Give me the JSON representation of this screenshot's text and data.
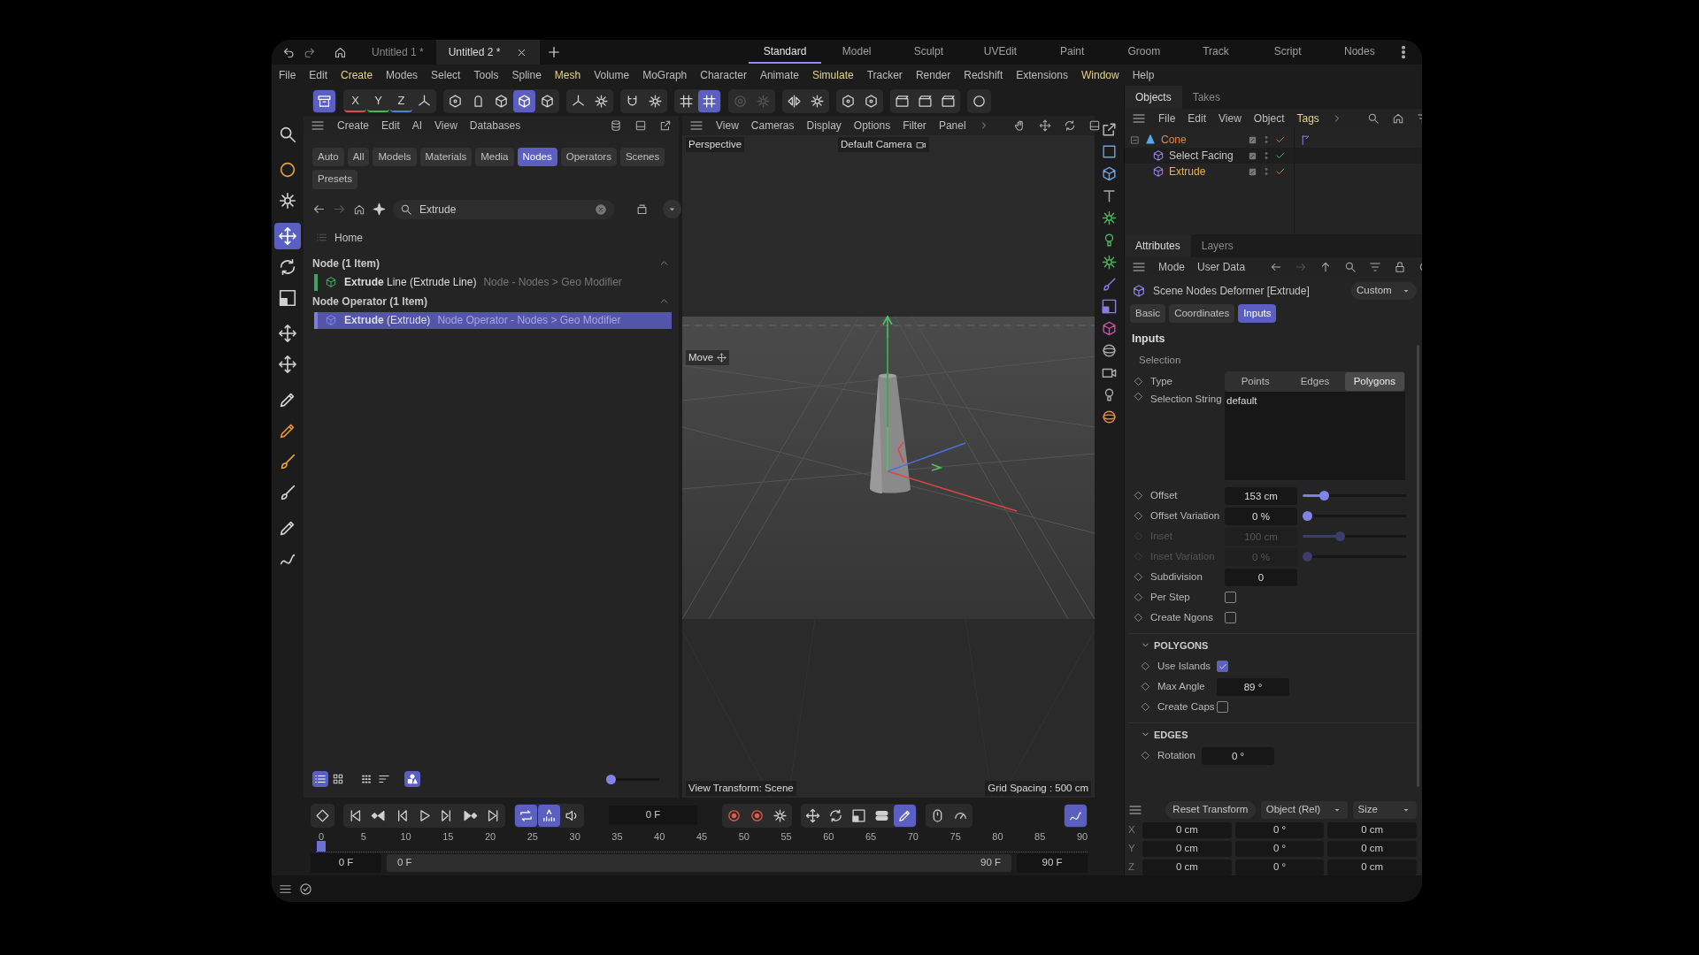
{
  "title_bar": {
    "documents": [
      {
        "label": "Untitled 1 *",
        "selected": false
      },
      {
        "label": "Untitled 2 *",
        "selected": true
      }
    ],
    "layouts": [
      {
        "label": "Standard",
        "selected": true
      },
      {
        "label": "Model",
        "selected": false
      },
      {
        "label": "Sculpt",
        "selected": false
      },
      {
        "label": "UVEdit",
        "selected": false
      },
      {
        "label": "Paint",
        "selected": false
      },
      {
        "label": "Groom",
        "selected": false
      },
      {
        "label": "Track",
        "selected": false
      },
      {
        "label": "Script",
        "selected": false
      },
      {
        "label": "Nodes",
        "selected": false
      }
    ]
  },
  "menu": [
    {
      "label": "File",
      "highlighted": false
    },
    {
      "label": "Edit",
      "highlighted": false
    },
    {
      "label": "Create",
      "highlighted": true
    },
    {
      "label": "Modes",
      "highlighted": false
    },
    {
      "label": "Select",
      "highlighted": false
    },
    {
      "label": "Tools",
      "highlighted": false
    },
    {
      "label": "Spline",
      "highlighted": false
    },
    {
      "label": "Mesh",
      "highlighted": true
    },
    {
      "label": "Volume",
      "highlighted": false
    },
    {
      "label": "MoGraph",
      "highlighted": false
    },
    {
      "label": "Character",
      "highlighted": false
    },
    {
      "label": "Animate",
      "highlighted": false
    },
    {
      "label": "Simulate",
      "highlighted": true
    },
    {
      "label": "Tracker",
      "highlighted": false
    },
    {
      "label": "Render",
      "highlighted": false
    },
    {
      "label": "Redshift",
      "highlighted": false
    },
    {
      "label": "Extensions",
      "highlighted": false
    },
    {
      "label": "Window",
      "highlighted": true
    },
    {
      "label": "Help",
      "highlighted": false
    }
  ],
  "toolbar": [
    [
      {
        "selected": true,
        "disabled": false
      }
    ],
    [
      {
        "label": "X",
        "selected": false,
        "disabled": false
      },
      {
        "label": "Y",
        "selected": false,
        "disabled": false
      },
      {
        "label": "Z",
        "selected": false,
        "disabled": false
      },
      {
        "selected": false,
        "disabled": false
      }
    ],
    [
      {
        "selected": false,
        "disabled": false
      },
      {
        "selected": false,
        "disabled": false
      },
      {
        "selected": false,
        "disabled": false
      },
      {
        "selected": true,
        "disabled": false
      },
      {
        "selected": false,
        "disabled": false
      }
    ],
    [
      {
        "selected": false,
        "disabled": false
      },
      {
        "selected": false,
        "disabled": false
      }
    ],
    [
      {
        "selected": false,
        "disabled": false
      },
      {
        "selected": false,
        "disabled": false
      }
    ],
    [
      {
        "selected": false,
        "disabled": false
      },
      {
        "selected": true,
        "disabled": false
      }
    ],
    [
      {
        "selected": false,
        "disabled": true
      },
      {
        "selected": false,
        "disabled": true
      }
    ],
    [
      {
        "selected": false,
        "disabled": false
      },
      {
        "selected": false,
        "disabled": false
      }
    ],
    [
      {
        "selected": false,
        "disabled": false
      },
      {
        "selected": false,
        "disabled": false
      }
    ],
    [
      {
        "selected": false,
        "disabled": false
      },
      {
        "selected": false,
        "disabled": false
      },
      {
        "selected": false,
        "disabled": false
      }
    ],
    [
      {
        "selected": false,
        "disabled": false
      }
    ]
  ],
  "tools": [
    {
      "selected": false
    },
    {
      "selected": false
    },
    {
      "selected": false
    },
    {
      "selected": true
    },
    {
      "selected": false
    },
    {
      "selected": false
    },
    {
      "selected": false
    },
    {
      "selected": false
    },
    {
      "selected": false
    },
    {
      "selected": false
    },
    {
      "selected": false
    },
    {
      "selected": false
    },
    {
      "selected": false
    },
    {
      "selected": false
    }
  ],
  "browser": {
    "menu": [
      "Create",
      "Edit",
      "AI",
      "View",
      "Databases"
    ],
    "filters": [
      {
        "label": "Auto",
        "selected": false
      },
      {
        "label": "All",
        "selected": false
      },
      {
        "label": "Models",
        "selected": false
      },
      {
        "label": "Materials",
        "selected": false
      },
      {
        "label": "Media",
        "selected": false
      },
      {
        "label": "Nodes",
        "selected": true
      },
      {
        "label": "Operators",
        "selected": false
      },
      {
        "label": "Scenes",
        "selected": false
      },
      {
        "label": "Presets",
        "selected": false
      }
    ],
    "search": {
      "value": "Extrude"
    },
    "breadcrumb": "Home",
    "groups": [
      {
        "title": "Node (1 Item)",
        "expanded": true,
        "items": [
          {
            "name": "**Extrude** Line (Extrude Line)",
            "path": "Node - Nodes > Geo Modifier",
            "color": "#3fa35f",
            "selected": false
          }
        ]
      },
      {
        "title": "Node Operator (1 Item)",
        "expanded": true,
        "items": [
          {
            "name": "**Extrude** (Extrude)",
            "path": "Node Operator - Nodes > Geo Modifier",
            "color": "#7a7fe0",
            "selected": true
          }
        ]
      }
    ],
    "view_buttons": [
      {
        "selected": true
      },
      {
        "selected": false
      },
      {
        "selected": false
      },
      {
        "selected": false
      },
      {
        "selected": true
      }
    ],
    "zoom": {
      "level": 0
    }
  },
  "viewport": {
    "menu": [
      "View",
      "Cameras",
      "Display",
      "Options",
      "Filter",
      "Panel"
    ],
    "view": "Perspective",
    "camera": "Default Camera",
    "tool": "Move",
    "view_transform": "View Transform: Scene",
    "grid_spacing": "Grid Spacing : 500 cm"
  },
  "objects": {
    "tabs": [
      {
        "label": "Objects",
        "selected": true
      },
      {
        "label": "Takes",
        "selected": false
      }
    ],
    "menu": [
      {
        "label": "File",
        "highlighted": false
      },
      {
        "label": "Edit",
        "highlighted": false
      },
      {
        "label": "View",
        "highlighted": false
      },
      {
        "label": "Object",
        "highlighted": false
      },
      {
        "label": "Tags",
        "highlighted": true
      }
    ],
    "tree": [
      {
        "label": "Cone",
        "kind": "primitive",
        "color": "#d98a45",
        "expanded": true,
        "enabled": true,
        "tagged": true,
        "children": [
          {
            "label": "Select Facing",
            "kind": "deformer",
            "color": "#c6c6c6",
            "enabled": true,
            "tagged": false
          },
          {
            "label": "Extrude",
            "kind": "deformer",
            "color": "#e8b44c",
            "enabled": true,
            "tagged": false
          }
        ]
      }
    ]
  },
  "attributes": {
    "tabs": [
      {
        "label": "Attributes",
        "selected": true
      },
      {
        "label": "Layers",
        "selected": false
      }
    ],
    "menu": [
      "Mode",
      "User Data"
    ],
    "object": "Scene Nodes Deformer [Extrude]",
    "preset": "Custom",
    "pages": [
      {
        "label": "Basic",
        "selected": false
      },
      {
        "label": "Coordinates",
        "selected": false
      },
      {
        "label": "Inputs",
        "selected": true
      }
    ],
    "heading": "Inputs",
    "group": "Selection",
    "rows": [
      {
        "kind": "segmented",
        "label": "Type",
        "disabled": false,
        "options": [
          {
            "label": "Points",
            "selected": false
          },
          {
            "label": "Edges",
            "selected": false
          },
          {
            "label": "Polygons",
            "selected": true
          }
        ]
      },
      {
        "kind": "textarea",
        "label": "Selection String",
        "disabled": false,
        "value": "default"
      },
      {
        "kind": "slider",
        "label": "Offset",
        "disabled": false,
        "value": "153 cm",
        "level": 0.18
      },
      {
        "kind": "slider",
        "label": "Offset Variation",
        "disabled": false,
        "value": "0 %",
        "level": 0
      },
      {
        "kind": "slider",
        "label": "Inset",
        "disabled": true,
        "value": "100 cm",
        "level": 0.35
      },
      {
        "kind": "slider",
        "label": "Inset Variation",
        "disabled": true,
        "value": "0 %",
        "level": 0
      },
      {
        "kind": "number",
        "label": "Subdivision",
        "disabled": false,
        "value": "0"
      },
      {
        "kind": "checkbox",
        "label": "Per Step",
        "disabled": false,
        "checked": false
      },
      {
        "kind": "checkbox",
        "label": "Create Ngons",
        "disabled": false,
        "checked": false
      }
    ],
    "sections": [
      {
        "title": "POLYGONS",
        "expanded": true,
        "rows": [
          {
            "kind": "checkbox",
            "label": "Use Islands",
            "disabled": false,
            "checked": true
          },
          {
            "kind": "number",
            "label": "Max Angle",
            "disabled": false,
            "value": "89 °"
          },
          {
            "kind": "checkbox",
            "label": "Create Caps",
            "disabled": false,
            "checked": false
          }
        ]
      },
      {
        "title": "EDGES",
        "expanded": true,
        "rows": [
          {
            "kind": "number",
            "label": "Rotation",
            "disabled": false,
            "value": "0 °"
          }
        ]
      }
    ]
  },
  "coordinates": {
    "reset": "Reset Transform",
    "mode": "Object (Rel)",
    "size_mode": "Size",
    "rows": [
      {
        "axis": "X",
        "values": [
          "0 cm",
          "0 °",
          "0 cm"
        ]
      },
      {
        "axis": "Y",
        "values": [
          "0 cm",
          "0 °",
          "0 cm"
        ]
      },
      {
        "axis": "Z",
        "values": [
          "0 cm",
          "0 °",
          "0 cm"
        ]
      }
    ]
  },
  "timeline": {
    "transport": [
      [
        {
          "selected": false
        }
      ],
      [
        {
          "selected": false
        },
        {
          "selected": false
        },
        {
          "selected": false
        },
        {
          "selected": false
        },
        {
          "selected": false
        },
        {
          "selected": false
        },
        {
          "selected": false
        }
      ],
      [
        {
          "selected": true
        },
        {
          "selected": true
        },
        {
          "selected": false
        }
      ]
    ],
    "frame": "0 F",
    "keys": [
      [
        {
          "selected": false
        },
        {
          "selected": false
        },
        {
          "selected": false
        }
      ],
      [
        {
          "selected": false
        },
        {
          "selected": false
        },
        {
          "selected": false
        },
        {
          "selected": false
        },
        {
          "selected": true
        }
      ],
      [
        {
          "selected": false
        },
        {
          "selected": false
        }
      ],
      [
        {
          "selected": true
        }
      ]
    ],
    "ruler": [
      "0",
      "5",
      "10",
      "15",
      "20",
      "25",
      "30",
      "35",
      "40",
      "45",
      "50",
      "55",
      "60",
      "65",
      "70",
      "75",
      "80",
      "85",
      "90"
    ],
    "playhead": {
      "level": 0
    },
    "range": {
      "start": "0 F",
      "from": "0 F",
      "to": "90 F",
      "end": "90 F"
    }
  }
}
